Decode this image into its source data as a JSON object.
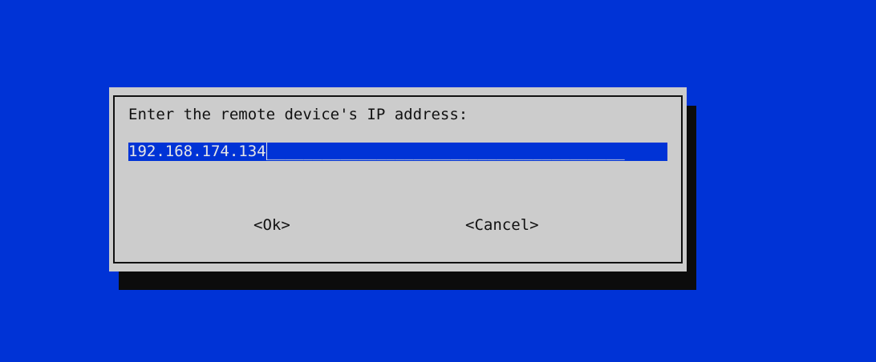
{
  "dialog": {
    "prompt": "Enter the remote device's IP address:",
    "input": {
      "value": "192.168.174.134",
      "fill": "_______________________________________"
    },
    "ok_label": "<Ok>",
    "cancel_label": "<Cancel>"
  },
  "colors": {
    "background": "#0033d6",
    "dialog": "#cccccc",
    "shadow": "#0c0c0c",
    "input_background": "#0033d6",
    "text": "#111111"
  }
}
